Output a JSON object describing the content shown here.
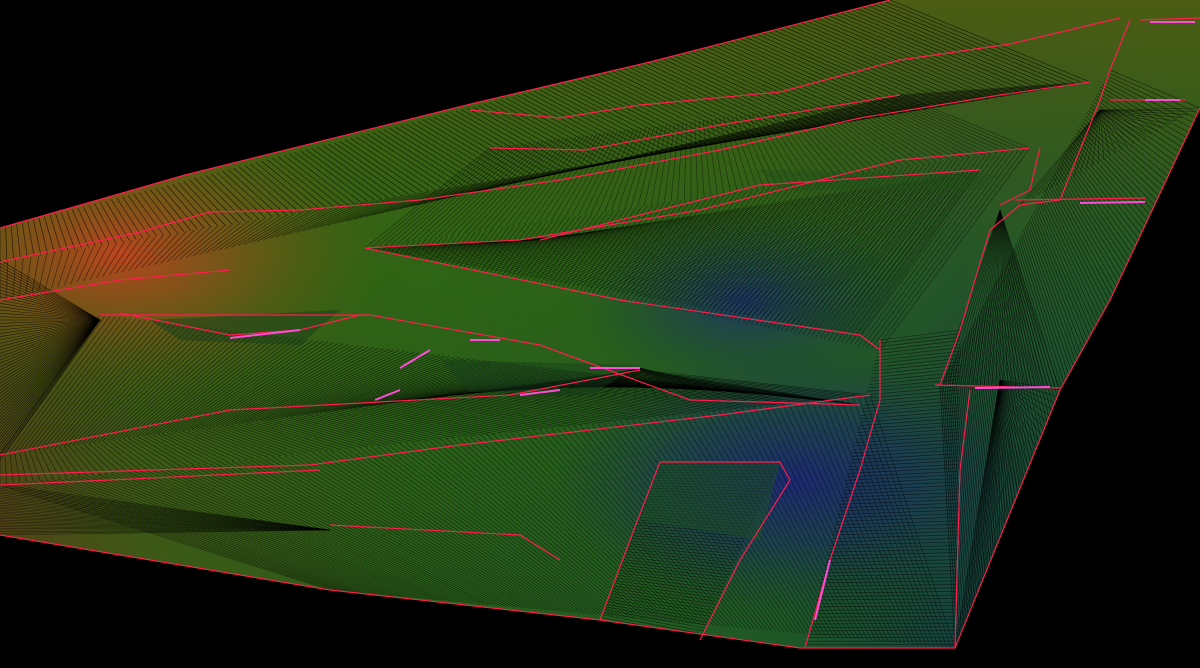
{
  "scene": {
    "kind": "3d-terrain-tin-mesh",
    "background_color": "#000000",
    "surface_colors": {
      "high": "#b5441c",
      "upper": "#6d6a12",
      "mid": "#2f6a16",
      "low": "#1d4e3b",
      "lowest": "#1a2f78"
    },
    "breakline_color": "#ff1d4d",
    "breakline_highlight_color": "#ff4cd8",
    "mesh_line_color": "#000000"
  }
}
